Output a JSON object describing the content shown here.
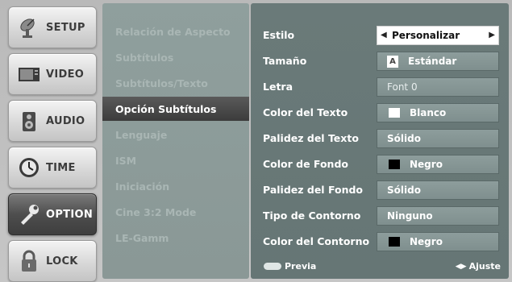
{
  "nav": {
    "items": [
      {
        "label": "SETUP",
        "icon": "satellite-dish-icon"
      },
      {
        "label": "VIDEO",
        "icon": "tv-screen-icon"
      },
      {
        "label": "AUDIO",
        "icon": "speaker-icon"
      },
      {
        "label": "TIME",
        "icon": "clock-icon"
      },
      {
        "label": "OPTION",
        "icon": "wrench-icon",
        "active": true
      },
      {
        "label": "LOCK",
        "icon": "padlock-icon"
      }
    ]
  },
  "submenu": {
    "items": [
      {
        "label": "Relación de Aspecto"
      },
      {
        "label": "Subtítulos"
      },
      {
        "label": "Subtítulos/Texto"
      },
      {
        "label": "Opción Subtítulos",
        "active": true
      },
      {
        "label": "Lenguaje"
      },
      {
        "label": "ISM"
      },
      {
        "label": "Iniciación"
      },
      {
        "label": "Cine 3:2 Mode"
      },
      {
        "label": "LE-Gamm"
      }
    ]
  },
  "settings": {
    "rows": [
      {
        "label": "Estilo",
        "value": "Personalizar",
        "selected": true
      },
      {
        "label": "Tamaño",
        "value": "Estándar",
        "badge": "A"
      },
      {
        "label": "Letra",
        "value": "Font 0"
      },
      {
        "label": "Color del Texto",
        "value": "Blanco",
        "swatch": "#ffffff"
      },
      {
        "label": "Palidez del Texto",
        "value": "Sólido"
      },
      {
        "label": "Color de Fondo",
        "value": "Negro",
        "swatch": "#000000"
      },
      {
        "label": "Palidez del Fondo",
        "value": "Sólido"
      },
      {
        "label": "Tipo de Contorno",
        "value": "Ninguno"
      },
      {
        "label": "Color del Contorno",
        "value": "Negro",
        "swatch": "#000000"
      }
    ]
  },
  "footer": {
    "preview_label": "Previa",
    "adjust_label": "Ajuste"
  },
  "colors": {
    "active_nav": "#4e4e4e",
    "panel_bg": "#6a7a79",
    "submenu_bg": "#8f9f9d"
  }
}
